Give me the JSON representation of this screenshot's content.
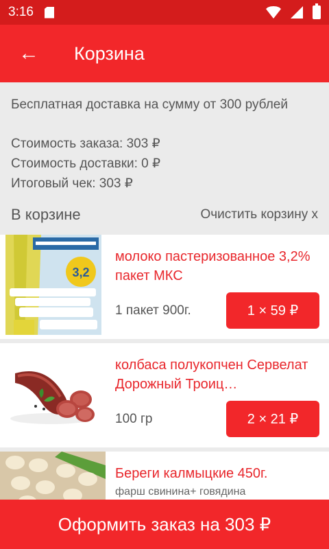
{
  "status": {
    "time": "3:16"
  },
  "appbar": {
    "back_icon": "←",
    "title": "Корзина"
  },
  "info": {
    "free_delivery": "Бесплатная доставка на сумму от 300 рублей",
    "order_cost": "Стоимость заказа: 303 ₽",
    "delivery_cost": "Стоимость доставки: 0 ₽",
    "total": "Итоговый чек: 303 ₽",
    "in_cart": "В корзине",
    "clear_cart": "Очистить корзину x"
  },
  "items": [
    {
      "name": "молоко пастеризованное 3,2% пакет МКС",
      "quantity_label": "1 пакет 900г.",
      "price_label": "1 × 59 ₽",
      "image": "milk-pack"
    },
    {
      "name": "колбаса полукопчен Сервелат Дорожный Троиц…",
      "quantity_label": "100 гр",
      "price_label": "2 × 21 ₽",
      "image": "sausage"
    },
    {
      "name": "Береги калмыцкие 450г.",
      "subtitle": "фарш свинина+ говядина",
      "image": "dumplings"
    }
  ],
  "checkout": {
    "label": "Оформить заказ на 303 ₽"
  },
  "colors": {
    "accent": "#f2272a",
    "statusbar": "#d41c1c",
    "background": "#ebebeb"
  }
}
